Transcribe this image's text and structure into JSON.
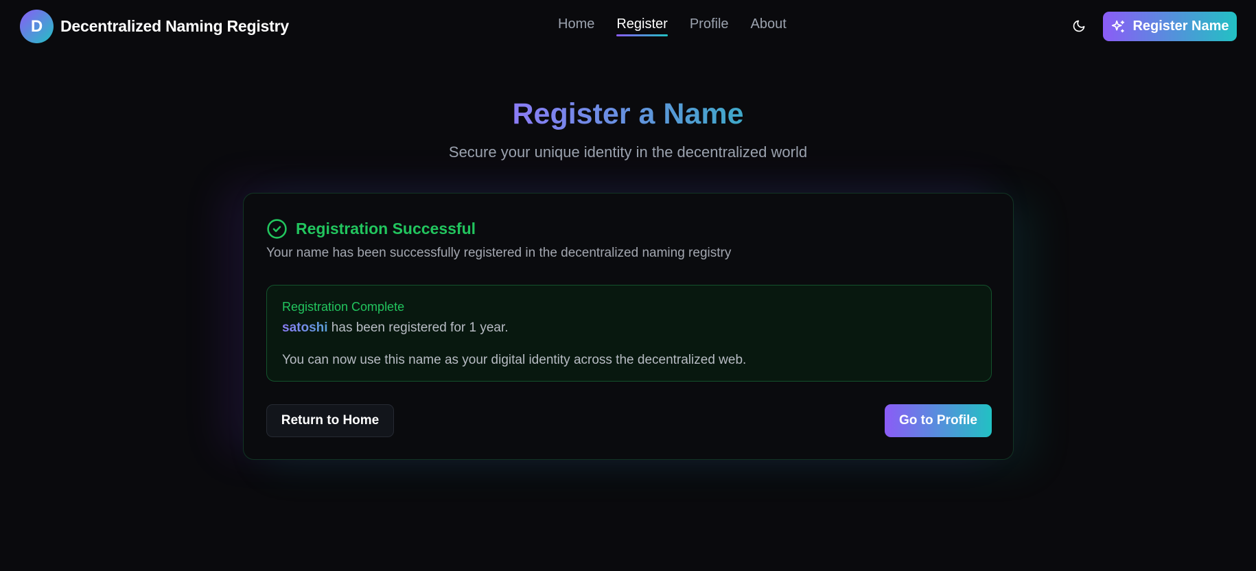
{
  "header": {
    "brand_initial": "D",
    "brand_name": "Decentralized Naming Registry",
    "nav": [
      {
        "label": "Home",
        "active": false
      },
      {
        "label": "Register",
        "active": true
      },
      {
        "label": "Profile",
        "active": false
      },
      {
        "label": "About",
        "active": false
      }
    ],
    "theme_icon": "moon-icon",
    "cta_icon": "sparkles-icon",
    "cta_label": "Register Name"
  },
  "hero": {
    "title": "Register a Name",
    "subtitle": "Secure your unique identity in the decentralized world"
  },
  "card": {
    "status_icon": "check-circle-icon",
    "title": "Registration Successful",
    "description": "Your name has been successfully registered in the decentralized naming registry",
    "notice": {
      "title": "Registration Complete",
      "registered_name": "satoshi",
      "registered_suffix": " has been registered for 1 year.",
      "body": "You can now use this name as your digital identity across the decentralized web."
    },
    "secondary_button": "Return to Home",
    "primary_button": "Go to Profile"
  },
  "colors": {
    "background": "#0a0a0d",
    "accent_start": "#8b5cf6",
    "accent_end": "#22c1c3",
    "success": "#22c55e"
  }
}
